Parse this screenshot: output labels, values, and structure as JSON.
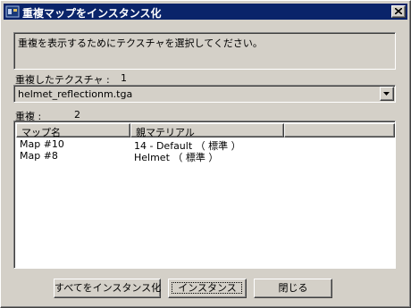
{
  "window": {
    "title": "重複マップをインスタンス化",
    "close_symbol": "×"
  },
  "info": {
    "message": "重複を表示するためにテクスチャを選択してください。"
  },
  "texture_section": {
    "label": "重複したテクスチャ :",
    "count": "1",
    "selected_texture": "helmet_reflectionm.tga"
  },
  "duplicates_section": {
    "label": "重複 :",
    "count": "2",
    "columns": [
      "マップ名",
      "親マテリアル"
    ],
    "rows": [
      {
        "map_name": "Map #10",
        "parent_material": "14 - Default （ 標準 ）"
      },
      {
        "map_name": "Map #8",
        "parent_material": "Helmet （ 標準 ）"
      }
    ]
  },
  "buttons": {
    "instance_all": "すべてをインスタンス化",
    "instance": "インスタンス",
    "close": "閉じる"
  },
  "colors": {
    "face": "#d4d0c8",
    "titlebar": "#0a246a"
  },
  "icons": {
    "app": "3dsmax-icon",
    "close": "close-icon",
    "dropdown": "chevron-down-icon"
  }
}
